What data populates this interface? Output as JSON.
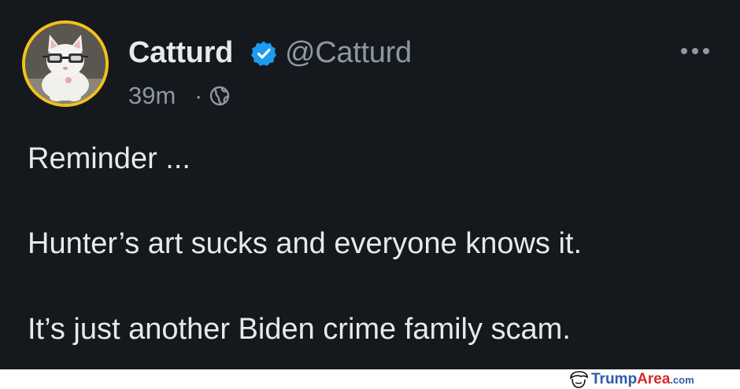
{
  "tweet": {
    "display_name": "Catturd",
    "handle": "@Catturd",
    "time": "39m",
    "separator": "·",
    "verified": true,
    "lines": [
      "Reminder ...",
      "Hunter’s art sucks and everyone knows it.",
      "It’s just another Biden crime family scam."
    ]
  },
  "icons": {
    "badge": "verified-badge-icon",
    "globe": "globe-icon",
    "more": "more-options-icon"
  },
  "watermark": {
    "brand": "Trump",
    "brand_accent": "Area",
    "suffix": ".com"
  },
  "colors": {
    "background": "#15181c",
    "text": "#e7e9ea",
    "muted": "#8b98a5",
    "verified": "#1d9bf0",
    "avatar_ring": "#f2c21b",
    "watermark_blue": "#2e5aa8",
    "watermark_red": "#d62a2a"
  }
}
